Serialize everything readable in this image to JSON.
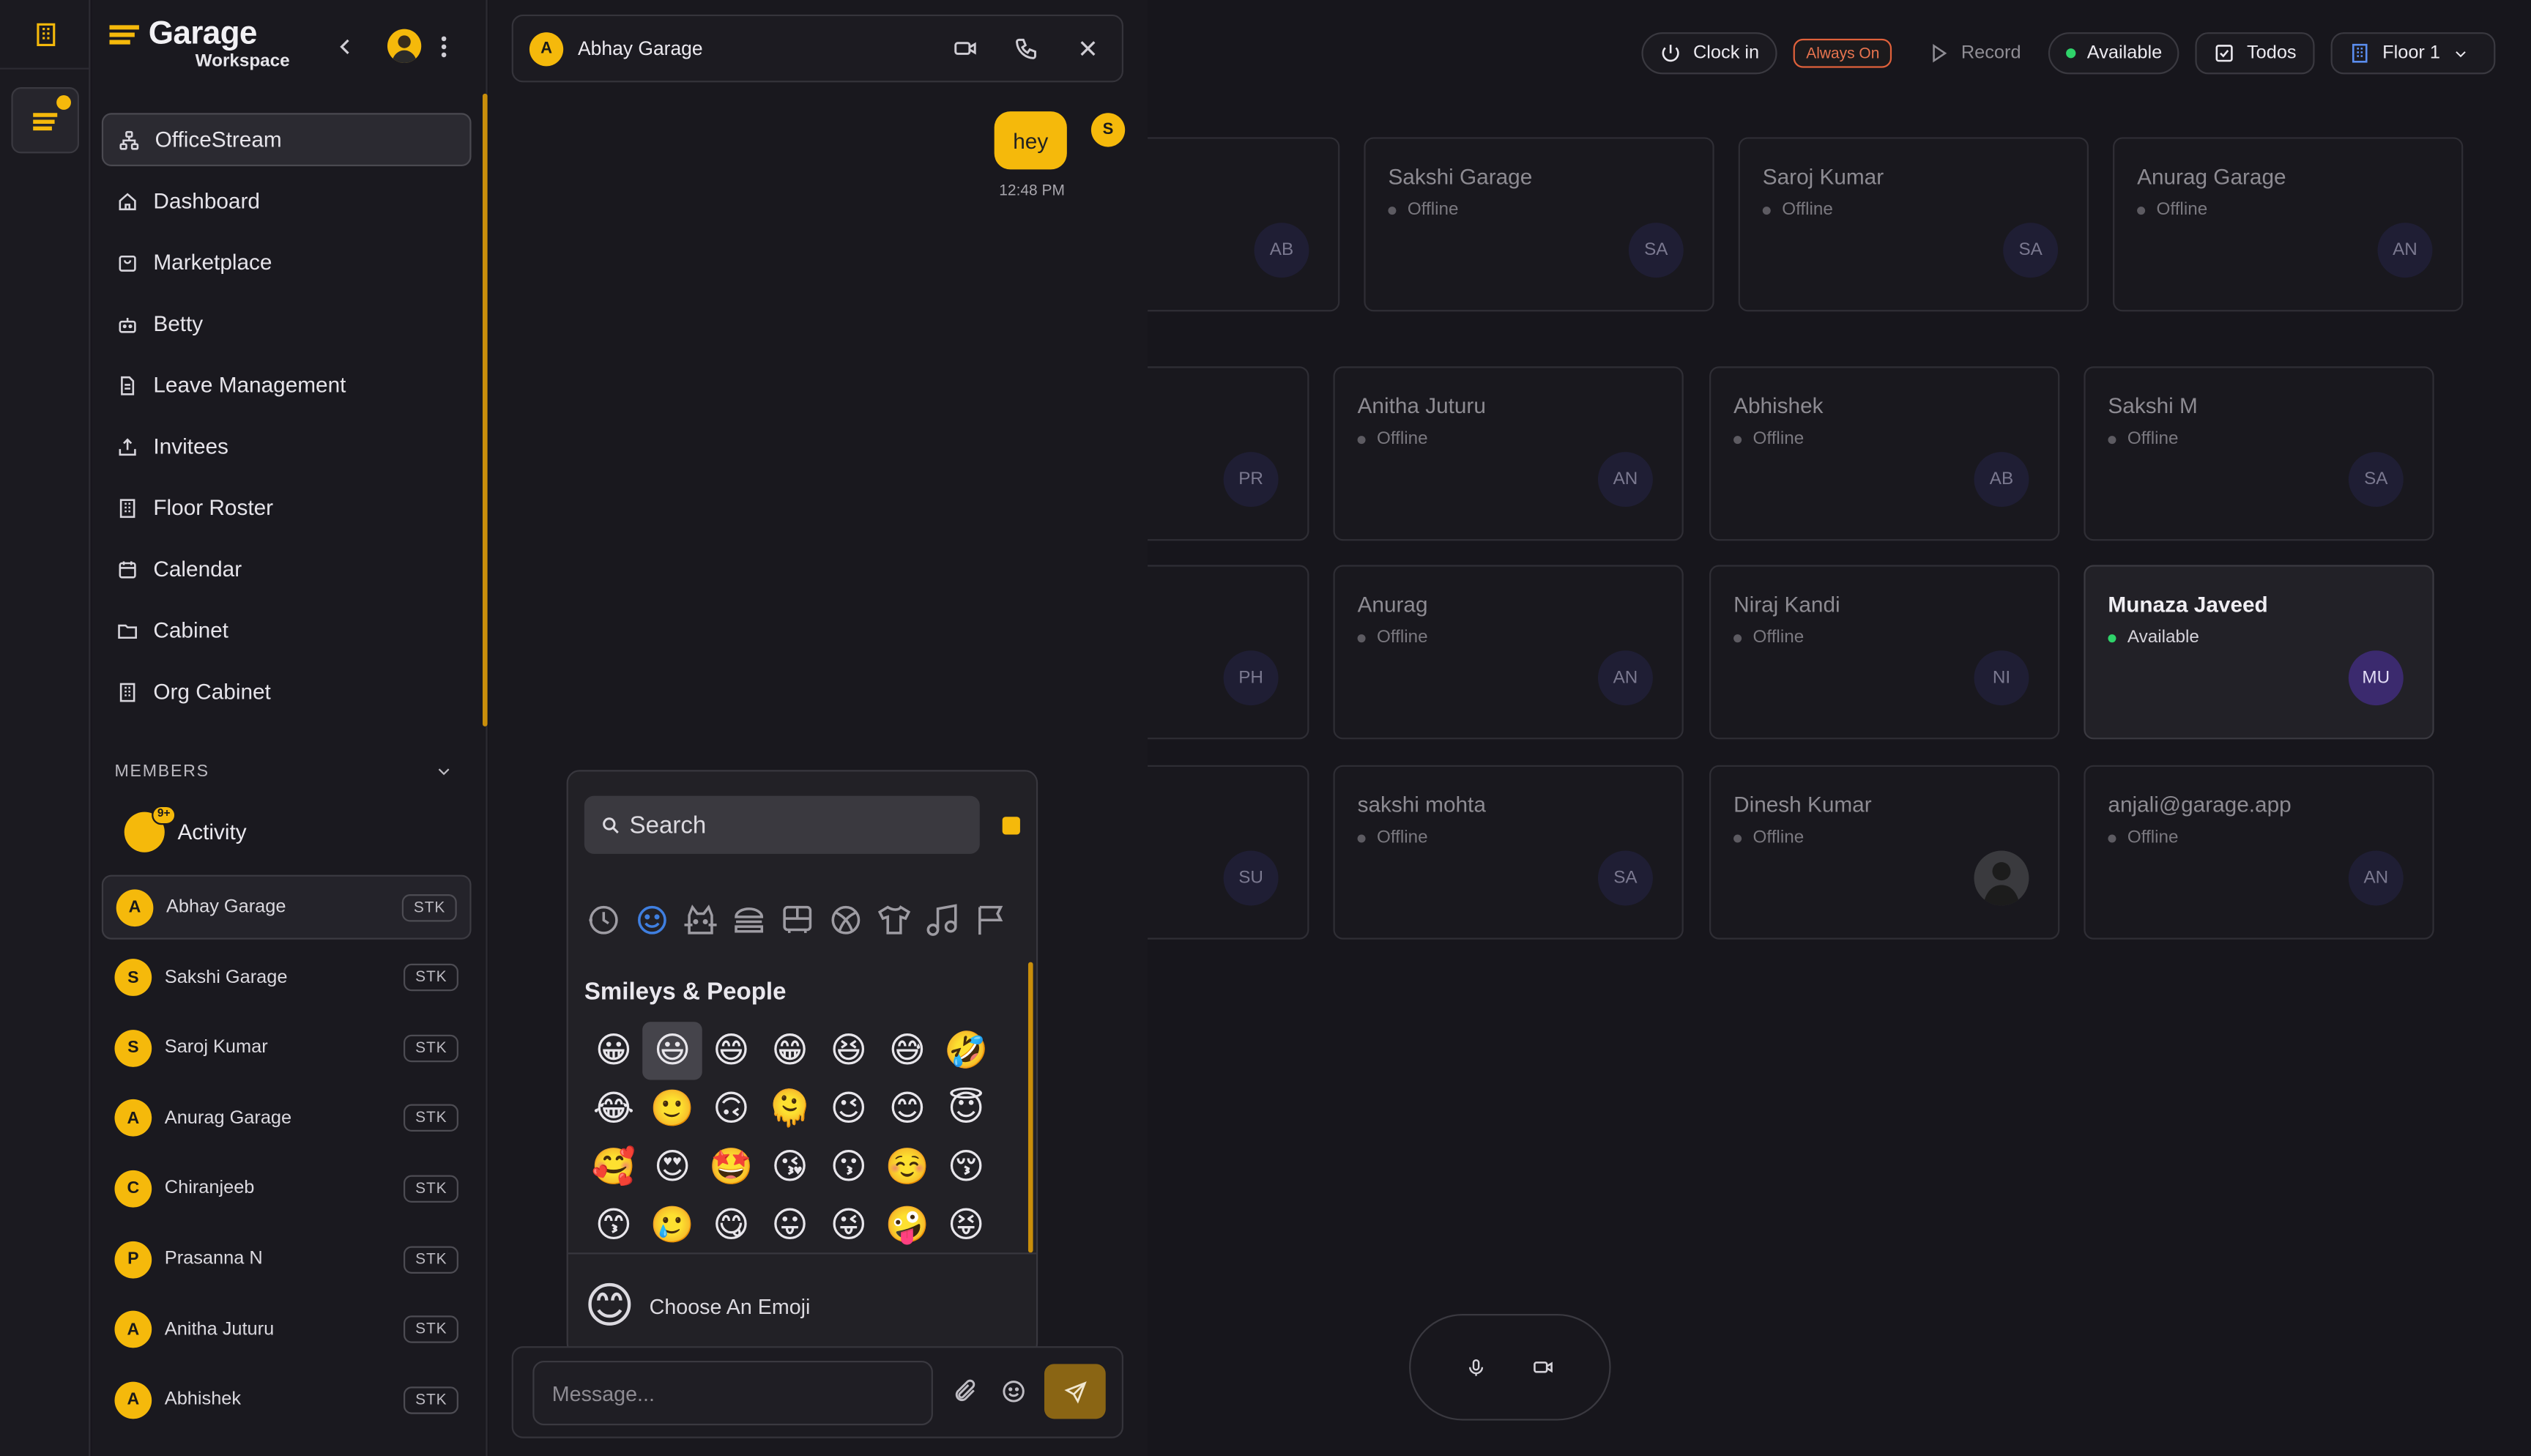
{
  "app": {
    "logo_name": "Garage",
    "logo_sub": "Workspace"
  },
  "sidebar": {
    "nav": [
      {
        "label": "OfficeStream",
        "icon": "network-icon",
        "active": true
      },
      {
        "label": "Dashboard",
        "icon": "home-icon"
      },
      {
        "label": "Marketplace",
        "icon": "shopping-bag-icon"
      },
      {
        "label": "Betty",
        "icon": "bot-icon"
      },
      {
        "label": "Leave Management",
        "icon": "document-icon"
      },
      {
        "label": "Invitees",
        "icon": "upload-icon"
      },
      {
        "label": "Floor Roster",
        "icon": "building-icon"
      },
      {
        "label": "Calendar",
        "icon": "calendar-icon"
      },
      {
        "label": "Cabinet",
        "icon": "folder-icon"
      },
      {
        "label": "Org Cabinet",
        "icon": "building-icon"
      }
    ],
    "members_heading": "MEMBERS",
    "activity": {
      "label": "Activity",
      "badge": "9+"
    },
    "members": [
      {
        "initial": "A",
        "name": "Abhay Garage",
        "tag": "STK",
        "active": true
      },
      {
        "initial": "S",
        "name": "Sakshi Garage",
        "tag": "STK"
      },
      {
        "initial": "S",
        "name": "Saroj Kumar",
        "tag": "STK"
      },
      {
        "initial": "A",
        "name": "Anurag Garage",
        "tag": "STK"
      },
      {
        "initial": "C",
        "name": "Chiranjeeb",
        "tag": "STK"
      },
      {
        "initial": "P",
        "name": "Prasanna N",
        "tag": "STK"
      },
      {
        "initial": "A",
        "name": "Anitha Juturu",
        "tag": "STK"
      },
      {
        "initial": "A",
        "name": "Abhishek",
        "tag": "STK"
      }
    ]
  },
  "chat": {
    "contact_initial": "A",
    "contact_name": "Abhay Garage",
    "messages": [
      {
        "text": "hey",
        "time": "12:48 PM",
        "sender_initial": "S"
      }
    ],
    "composer_placeholder": "Message..."
  },
  "emoji_picker": {
    "search_placeholder": "Search",
    "categories": [
      "clock-icon",
      "smiley-icon",
      "cat-icon",
      "burger-icon",
      "bus-icon",
      "ball-icon",
      "shirt-icon",
      "music-icon",
      "flag-icon"
    ],
    "section": "Smileys & People",
    "emojis": [
      "😀",
      "😃",
      "😄",
      "😁",
      "😆",
      "😅",
      "🤣",
      "😂",
      "🙂",
      "🙃",
      "🫠",
      "😉",
      "😊",
      "😇",
      "🥰",
      "😍",
      "🤩",
      "😘",
      "😗",
      "☺️",
      "😚",
      "😙",
      "🥲",
      "😋",
      "😛",
      "😜",
      "🤪",
      "😝"
    ],
    "selected_index": 1,
    "footer_emoji": "😊",
    "footer_label": "Choose An Emoji"
  },
  "topbar": {
    "clock_in": "Clock in",
    "always_on": "Always On",
    "record": "Record",
    "available": "Available",
    "todos": "Todos",
    "floor": "Floor 1"
  },
  "colors": {
    "accent": "#f5b90b",
    "online": "#2fd36a",
    "offline": "#5d5b62",
    "warning": "#e9744f"
  },
  "cards": [
    {
      "name": "",
      "status": "",
      "initials": "AB"
    },
    {
      "name": "Sakshi Garage",
      "status": "Offline",
      "initials": "SA"
    },
    {
      "name": "Saroj Kumar",
      "status": "Offline",
      "initials": "SA"
    },
    {
      "name": "Anurag Garage",
      "status": "Offline",
      "initials": "AN"
    },
    {
      "name": "",
      "status": "",
      "initials": "PR"
    },
    {
      "name": "Anitha Juturu",
      "status": "Offline",
      "initials": "AN"
    },
    {
      "name": "Abhishek",
      "status": "Offline",
      "initials": "AB"
    },
    {
      "name": "Sakshi M",
      "status": "Offline",
      "initials": "SA"
    },
    {
      "name": "",
      "status": "",
      "initials": "PH"
    },
    {
      "name": "Anurag",
      "status": "Offline",
      "initials": "AN"
    },
    {
      "name": "Niraj Kandi",
      "status": "Offline",
      "initials": "NI"
    },
    {
      "name": "Munaza Javeed",
      "status": "Available",
      "initials": "MU"
    },
    {
      "name": "",
      "status": "",
      "initials": "SU"
    },
    {
      "name": "sakshi mohta",
      "status": "Offline",
      "initials": "SA"
    },
    {
      "name": "Dinesh Kumar",
      "status": "Offline",
      "initials": ""
    },
    {
      "name": "anjali@garage.app",
      "status": "Offline",
      "initials": "AN"
    }
  ]
}
